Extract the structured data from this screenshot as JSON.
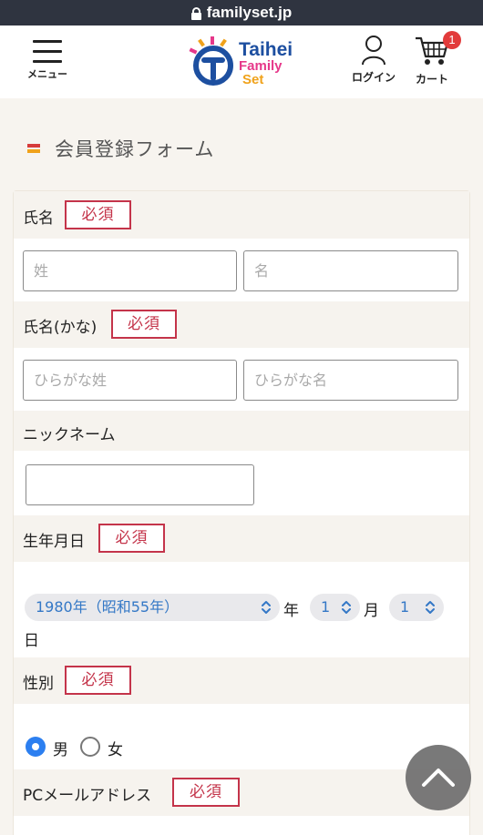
{
  "browser": {
    "url": "familyset.jp"
  },
  "header": {
    "menu_label": "メニュー",
    "logo": {
      "line1": "Taihei",
      "line2": "Family",
      "line3": "Set"
    },
    "login_label": "ログイン",
    "cart_label": "カート",
    "cart_count": "1"
  },
  "page": {
    "title": "会員登録フォーム"
  },
  "form": {
    "required_badge": "必須",
    "name": {
      "label": "氏名",
      "last_placeholder": "姓",
      "first_placeholder": "名"
    },
    "name_kana": {
      "label": "氏名(かな)",
      "last_placeholder": "ひらがな姓",
      "first_placeholder": "ひらがな名"
    },
    "nickname": {
      "label": "ニックネーム",
      "value": ""
    },
    "birthday": {
      "label": "生年月日",
      "year_value": "1980年（昭和55年）",
      "year_suffix": "年",
      "month_value": "1",
      "month_suffix": "月",
      "day_value": "1",
      "day_suffix": "日"
    },
    "gender": {
      "label": "性別",
      "options": [
        {
          "label": "男",
          "selected": true
        },
        {
          "label": "女",
          "selected": false
        }
      ]
    },
    "pc_email": {
      "label": "PCメールアドレス"
    }
  },
  "colors": {
    "required": "#c4344a",
    "select_text": "#3478c6",
    "radio_on": "#2c7ff0",
    "url_bar": "#2f3440"
  }
}
